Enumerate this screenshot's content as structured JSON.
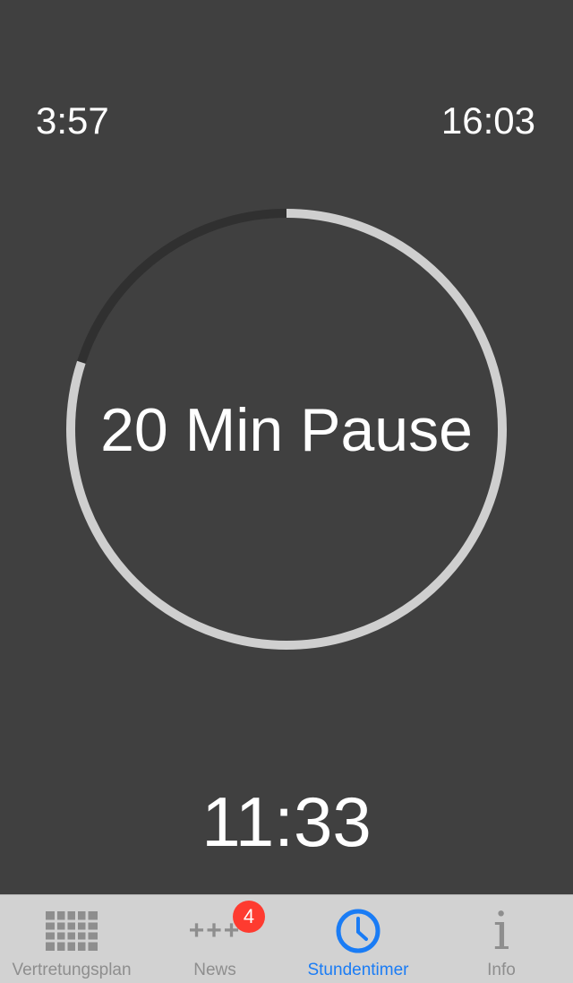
{
  "header": {
    "elapsed": "3:57",
    "end_time": "16:03"
  },
  "timer": {
    "label": "20 Min Pause",
    "countdown": "11:33",
    "progress_fraction": 0.8
  },
  "colors": {
    "background": "#404040",
    "ring_progress": "#cfcfcf",
    "ring_track": "#303030",
    "active_tab": "#1a7cf5",
    "inactive_tab": "#8e8e8e",
    "badge": "#fe3b30"
  },
  "tabbar": {
    "tabs": [
      {
        "label": "Vertretungsplan",
        "icon": "grid-icon",
        "active": false
      },
      {
        "label": "News",
        "icon": "plus-icon",
        "active": false,
        "badge": "4"
      },
      {
        "label": "Stundentimer",
        "icon": "clock-icon",
        "active": true
      },
      {
        "label": "Info",
        "icon": "info-icon",
        "active": false
      }
    ]
  }
}
